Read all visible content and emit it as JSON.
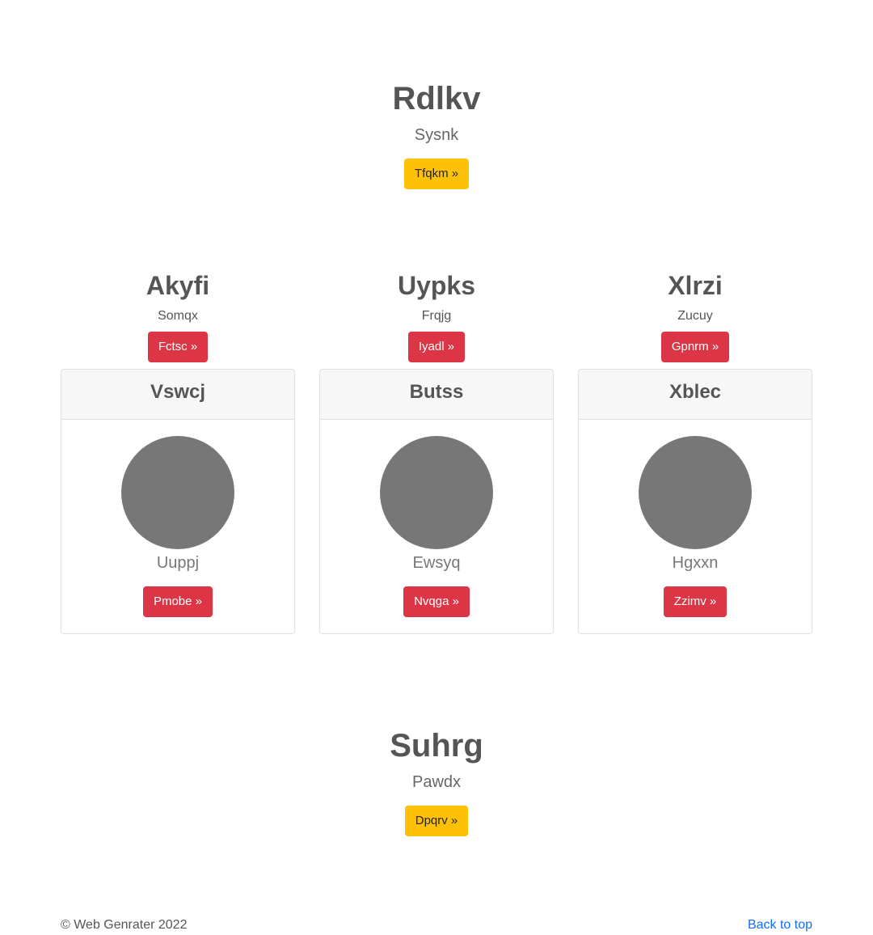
{
  "hero_top": {
    "title": "Rdlkv",
    "subtitle": "Sysnk",
    "button": "Tfqkm »"
  },
  "features": [
    {
      "title": "Akyfi",
      "subtitle": "Somqx",
      "button": "Fctsc »"
    },
    {
      "title": "Uypks",
      "subtitle": "Frqjg",
      "button": "Iyadl »"
    },
    {
      "title": "Xlrzi",
      "subtitle": "Zucuy",
      "button": "Gpnrm »"
    }
  ],
  "cards": [
    {
      "header": "Vswcj",
      "text": "Uuppj",
      "button": "Pmobe »"
    },
    {
      "header": "Butss",
      "text": "Ewsyq",
      "button": "Nvqga »"
    },
    {
      "header": "Xblec",
      "text": "Hgxxn",
      "button": "Zzimv »"
    }
  ],
  "hero_bottom": {
    "title": "Suhrg",
    "subtitle": "Pawdx",
    "button": "Dpqrv »"
  },
  "footer": {
    "copyright": "© Web Genrater 2022",
    "back_to_top": "Back to top"
  },
  "colors": {
    "warning": "#ffc107",
    "danger": "#dc3545",
    "link": "#0d6efd",
    "avatar": "#777777"
  }
}
